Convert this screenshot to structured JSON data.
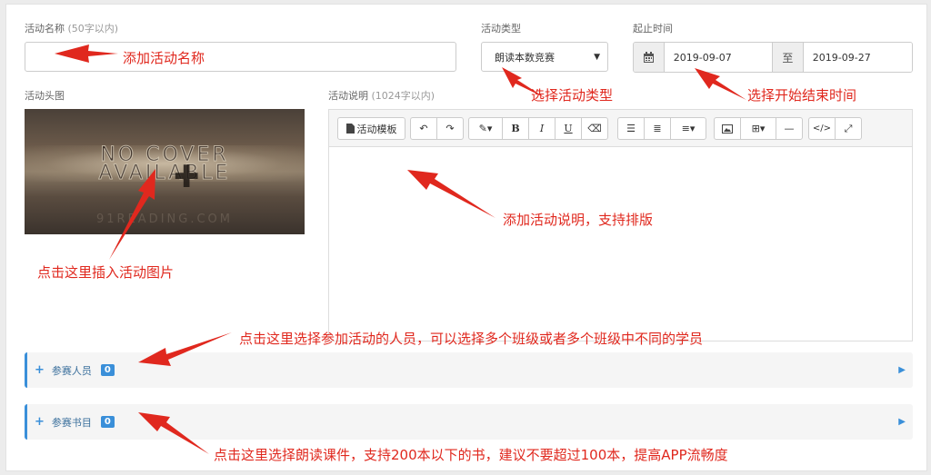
{
  "form": {
    "name_label": "活动名称",
    "name_hint": "(50字以内)",
    "name_value": "",
    "type_label": "活动类型",
    "type_selected": "朗读本数竞赛",
    "time_label": "起止时间",
    "start_date": "2019-09-07",
    "to_text": "至",
    "end_date": "2019-09-27",
    "cover_label": "活动头图",
    "cover_text_1": "NO COVER",
    "cover_text_2": "AVAILABLE",
    "cover_watermark": "91READING.COM",
    "desc_label": "活动说明",
    "desc_hint": "(1024字以内)"
  },
  "toolbar": {
    "template_label": "活动模板",
    "bold_label": "B",
    "italic_label": "I",
    "underline_label": "U",
    "code_label": "</>"
  },
  "sections": {
    "participants_label": "参赛人员",
    "participants_count": "0",
    "books_label": "参赛书目",
    "books_count": "0"
  },
  "annotations": {
    "name": "添加活动名称",
    "type": "选择活动类型",
    "time": "选择开始结束时间",
    "desc": "添加活动说明，支持排版",
    "cover": "点击这里插入活动图片",
    "participants": "点击这里选择参加活动的人员，可以选择多个班级或者多个班级中不同的学员",
    "books": "点击这里选择朗读课件，支持200本以下的书，建议不要超过100本，提高APP流畅度"
  },
  "colors": {
    "accent": "#3a8fd9",
    "annotation": "#e0281e"
  }
}
